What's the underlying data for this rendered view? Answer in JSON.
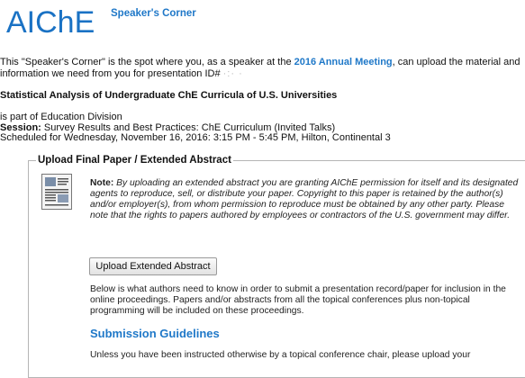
{
  "header": {
    "logo": "AIChE",
    "section_title": "Speaker's Corner"
  },
  "intro": {
    "text_before_link": "This \"Speaker's Corner\" is the spot where you, as a speaker at the ",
    "meeting_link": "2016 Annual Meeting",
    "text_after_link": ", can upload the material and",
    "line2": "information we need from you for presentation ID# ",
    "presentation_id": "·:· ·"
  },
  "presentation": {
    "title": "Statistical Analysis of Undergraduate ChE Curricula of U.S. Universities",
    "division": "is part of Education Division",
    "session_label": "Session:",
    "session": " Survey Results and Best Practices: ChE Curriculum (Invited Talks)",
    "schedule": "Scheduled for Wednesday, November 16, 2016: 3:15 PM - 5:45 PM, Hilton, Continental 3"
  },
  "upload": {
    "legend": "Upload Final Paper / Extended Abstract",
    "note_label": "Note:",
    "note_text": " By uploading an extended abstract you are granting AIChE permission for itself and its designated agents to reproduce, sell, or distribute your paper. Copyright to this paper is retained by the author(s) and/or employer(s), from whom permission to reproduce must be obtained by any other party. Please note that the rights to papers authored by employees or contractors of the U.S. government may differ.",
    "button_label": "Upload Extended Abstract",
    "below_text": "Below is what authors need to know in order to submit a presentation record/paper for inclusion in the online proceedings. Papers and/or abstracts from all the topical conferences plus non-topical programming will be included on these proceedings.",
    "guidelines_heading": "Submission Guidelines",
    "guidelines_text": "Unless you have been instructed otherwise by a topical conference chair, please upload your"
  },
  "colors": {
    "brand": "#1a72c4",
    "link": "#1f78c8"
  }
}
